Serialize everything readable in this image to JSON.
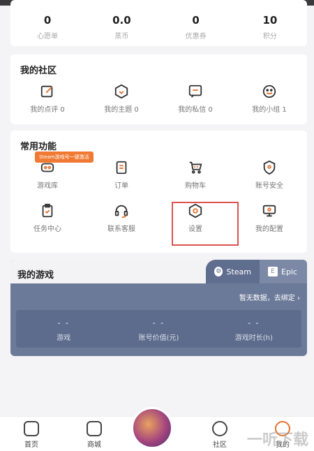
{
  "stats": [
    {
      "value": "0",
      "label": "心愿单"
    },
    {
      "value": "0.0",
      "label": "蒸币"
    },
    {
      "value": "0",
      "label": "优惠券"
    },
    {
      "value": "10",
      "label": "积分"
    }
  ],
  "community": {
    "title": "我的社区",
    "items": [
      {
        "label": "我的点评 0",
        "icon": "edit-icon"
      },
      {
        "label": "我的主题 0",
        "icon": "topic-icon"
      },
      {
        "label": "我的私信 0",
        "icon": "message-icon"
      },
      {
        "label": "我的小组 1",
        "icon": "group-icon"
      }
    ]
  },
  "functions": {
    "title": "常用功能",
    "tooltip": "Steam游戏号一键激活",
    "items": [
      {
        "label": "游戏库",
        "icon": "gamepad-icon"
      },
      {
        "label": "订单",
        "icon": "order-icon"
      },
      {
        "label": "购物车",
        "icon": "cart-icon"
      },
      {
        "label": "账号安全",
        "icon": "shield-icon"
      },
      {
        "label": "任务中心",
        "icon": "task-icon"
      },
      {
        "label": "联系客服",
        "icon": "headset-icon"
      },
      {
        "label": "设置",
        "icon": "settings-icon"
      },
      {
        "label": "我的配置",
        "icon": "monitor-icon"
      }
    ]
  },
  "games": {
    "title": "我的游戏",
    "tabs": [
      "Steam",
      "Epic"
    ],
    "no_data": "暂无数据，去绑定 ›",
    "stats": [
      {
        "value": "- -",
        "label": "游戏"
      },
      {
        "value": "- -",
        "label": "账号价值(元)"
      },
      {
        "value": "- -",
        "label": "游戏时长(h)"
      }
    ]
  },
  "nav": {
    "home": "首页",
    "store": "商城",
    "community": "社区",
    "mine": "我的"
  },
  "watermark": "一听下载"
}
